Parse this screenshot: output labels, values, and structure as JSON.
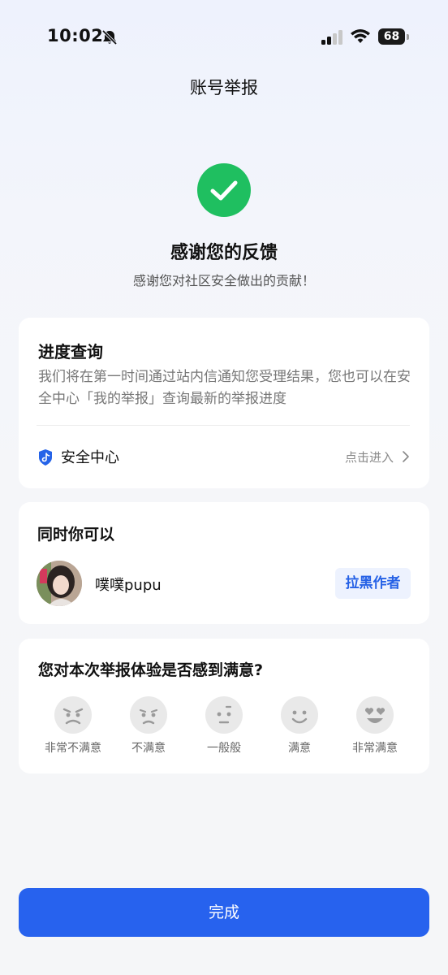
{
  "status_bar": {
    "time": "10:02",
    "battery": "68",
    "icons": [
      "bell-slash-icon",
      "signal-icon",
      "wifi-icon",
      "battery-icon"
    ]
  },
  "header": {
    "title": "账号举报"
  },
  "result": {
    "icon": "check-circle-icon",
    "headline": "感谢您的反馈",
    "subline": "感谢您对社区安全做出的贡献！"
  },
  "progress_card": {
    "title": "进度查询",
    "description": "我们将在第一时间通过站内信通知您受理结果，您也可以在安全中心「我的举报」查询最新的举报进度",
    "security_center": {
      "icon": "shield-icon",
      "label": "安全中心",
      "action": "点击进入"
    }
  },
  "also_card": {
    "title": "同时你可以",
    "user": {
      "name": "噗噗pupu"
    },
    "block_label": "拉黑作者"
  },
  "rating_card": {
    "title": "您对本次举报体验是否感到满意?",
    "options": [
      {
        "icon": "angry-face-icon",
        "label": "非常不满意"
      },
      {
        "icon": "frown-face-icon",
        "label": "不满意"
      },
      {
        "icon": "neutral-face-icon",
        "label": "一般般"
      },
      {
        "icon": "smile-face-icon",
        "label": "满意"
      },
      {
        "icon": "heart-eyes-face-icon",
        "label": "非常满意"
      }
    ]
  },
  "footer": {
    "done_label": "完成"
  },
  "colors": {
    "accent": "#2762ee",
    "success": "#1fbf60",
    "block_text": "#2561e6",
    "block_bg": "#edf2fe"
  }
}
